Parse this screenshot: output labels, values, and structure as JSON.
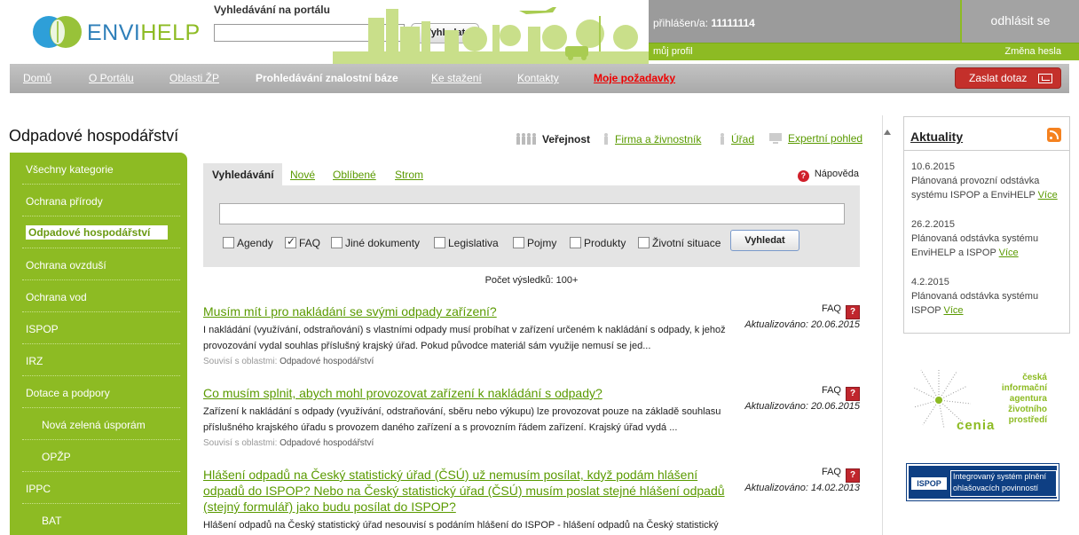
{
  "header": {
    "logo_prefix": "ENVI",
    "logo_suffix": "HELP",
    "search_title": "Vyhledávání na portálu",
    "search_placeholder": "",
    "search_button": "Vyhledat"
  },
  "user": {
    "login_label": "přihlášen/a:",
    "login_id": "11111114",
    "logout": "odhlásit se",
    "profile": "můj profil",
    "change_password": "Změna hesla"
  },
  "topnav": {
    "items": [
      "Domů",
      "O Portálu",
      "Oblasti ŽP",
      "Prohledávání znalostní báze",
      "Ke stažení",
      "Kontakty",
      "Moje požadavky"
    ],
    "ask_button": "Zaslat dotaz"
  },
  "left": {
    "section_title": "Odpadové hospodářství",
    "items": [
      "Všechny kategorie",
      "Ochrana přírody",
      "Odpadové hospodářství",
      "Ochrana ovzduší",
      "Ochrana vod",
      "ISPOP",
      "IRZ",
      "Dotace a podpory",
      "Nová zelená úsporám",
      "OPŽP",
      "IPPC",
      "BAT"
    ]
  },
  "views": {
    "public": "Veřejnost",
    "business": "Firma a živnostník",
    "office": "Úřad",
    "expert": "Expertní pohled"
  },
  "search_panel": {
    "tabs": [
      "Vyhledávání",
      "Nové",
      "Oblíbené",
      "Strom"
    ],
    "help": "Nápověda",
    "query": "",
    "filters": [
      {
        "label": "Agendy",
        "checked": false
      },
      {
        "label": "FAQ",
        "checked": true
      },
      {
        "label": "Jiné dokumenty",
        "checked": false
      },
      {
        "label": "Legislativa",
        "checked": false
      },
      {
        "label": "Pojmy",
        "checked": false
      },
      {
        "label": "Produkty",
        "checked": false
      },
      {
        "label": "Životní situace",
        "checked": false
      }
    ],
    "button": "Vyhledat",
    "count": "Počet výsledků: 100+"
  },
  "results": [
    {
      "title": "Musím mít i pro nakládání se svými odpady zařízení?",
      "snippet": "I nakládání (využívání, odstraňování) s vlastními odpady musí probíhat v zařízení určeném k nakládání s odpady, k jehož provozování vydal souhlas příslušný krajský úřad. Pokud původce materiál sám využije nemusí se jed...",
      "related_label": "Souvisí s oblastmi:",
      "related": "Odpadové hospodářství",
      "type": "FAQ",
      "date": "Aktualizováno: 20.06.2015"
    },
    {
      "title": "Co musím splnit, abych mohl provozovat zařízení k nakládání s odpady?",
      "snippet": "Zařízení k nakládání s odpady (využívání, odstraňování, sběru nebo výkupu) lze provozovat pouze na základě souhlasu příslušného krajského úřadu s provozem daného zařízení a s provozním řádem zařízení. Krajský úřad vydá ...",
      "related_label": "Souvisí s oblastmi:",
      "related": "Odpadové hospodářství",
      "type": "FAQ",
      "date": "Aktualizováno: 20.06.2015"
    },
    {
      "title": "Hlášení odpadů na Český statistický úřad (ČSÚ) už nemusím posílat, když podám hlášení odpadů do ISPOP? Nebo na Český statistický úřad (ČSÚ) musím poslat stejné hlášení odpadů (stejný formulář) jako budu posílat do ISPOP?",
      "snippet": "Hlášení odpadů na Český statistický úřad nesouvisí s podáním hlášení do ISPOP - hlášení odpadů na Český statistický úřad",
      "type": "FAQ",
      "date": "Aktualizováno: 14.02.2013"
    }
  ],
  "news": {
    "title": "Aktuality",
    "items": [
      {
        "date": "10.6.2015",
        "text": "Plánovaná provozní odstávka systému ISPOP a EnviHELP",
        "more": "Více"
      },
      {
        "date": "26.2.2015",
        "text": "Plánovaná odstávka systému EnviHELP a ISPOP",
        "more": "Více"
      },
      {
        "date": "4.2.2015",
        "text": "Plánovaná odstávka systému ISPOP",
        "more": "Více"
      }
    ]
  },
  "cenia": {
    "lines": [
      "česká",
      "informační",
      "agentura",
      "životního",
      "prostředí"
    ],
    "word": "cenia"
  },
  "ispop": {
    "logo": "ISPOP",
    "text": "Integrovaný systém plnění ohlašovacích povinností"
  },
  "colors": {
    "green": "#8dbb23",
    "link_green": "#5a9a00",
    "nav_gray": "#b0b0b0",
    "red": "#c4302b",
    "blue": "#2e7fb9"
  }
}
